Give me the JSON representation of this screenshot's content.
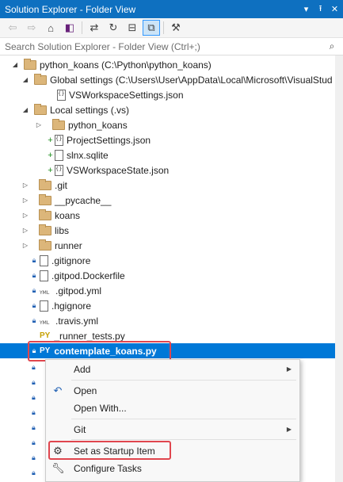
{
  "window": {
    "title": "Solution Explorer - Folder View",
    "title_buttons": [
      "▾",
      "⭱",
      "✕"
    ]
  },
  "search": {
    "placeholder": "Search Solution Explorer - Folder View (Ctrl+;)"
  },
  "tree": [
    {
      "label": "python_koans (C:\\Python\\python_koans)",
      "level": 0,
      "type": "folder",
      "expanded": true
    },
    {
      "label": "Global settings (C:\\Users\\User\\AppData\\Local\\Microsoft\\VisualStud",
      "level": 1,
      "type": "folder",
      "expanded": true
    },
    {
      "label": "VSWorkspaceSettings.json",
      "level": 2,
      "type": "json"
    },
    {
      "label": "Local settings (.vs)",
      "level": 1,
      "type": "folder",
      "expanded": true
    },
    {
      "label": "python_koans",
      "level": 2,
      "type": "folder",
      "expanded": false
    },
    {
      "label": "ProjectSettings.json",
      "level": 2,
      "type": "json",
      "added": true
    },
    {
      "label": "slnx.sqlite",
      "level": 2,
      "type": "file",
      "added": true
    },
    {
      "label": "VSWorkspaceState.json",
      "level": 2,
      "type": "json",
      "added": true
    },
    {
      "label": ".git",
      "level": 1,
      "type": "folder",
      "expanded": false
    },
    {
      "label": "__pycache__",
      "level": 1,
      "type": "folder",
      "expanded": false
    },
    {
      "label": "koans",
      "level": 1,
      "type": "folder",
      "expanded": false
    },
    {
      "label": "libs",
      "level": 1,
      "type": "folder",
      "expanded": false
    },
    {
      "label": "runner",
      "level": 1,
      "type": "folder",
      "expanded": false
    },
    {
      "label": ".gitignore",
      "level": 1,
      "type": "locked-file"
    },
    {
      "label": ".gitpod.Dockerfile",
      "level": 1,
      "type": "locked-file"
    },
    {
      "label": ".gitpod.yml",
      "level": 1,
      "type": "yml"
    },
    {
      "label": ".hgignore",
      "level": 1,
      "type": "locked-file"
    },
    {
      "label": ".travis.yml",
      "level": 1,
      "type": "yml"
    },
    {
      "label": "_runner_tests.py",
      "level": 1,
      "type": "py-yellow"
    },
    {
      "label": "contemplate_koans.py",
      "level": 1,
      "type": "py",
      "selected": true
    }
  ],
  "context_menu": {
    "add": "Add",
    "open": "Open",
    "open_with": "Open With...",
    "git": "Git",
    "set_startup": "Set as Startup Item",
    "configure_tasks": "Configure Tasks"
  },
  "glyphs": {
    "py": "PY",
    "yml": "YML"
  },
  "accent_color": "#0078d7",
  "highlight_color": "#e0464e"
}
